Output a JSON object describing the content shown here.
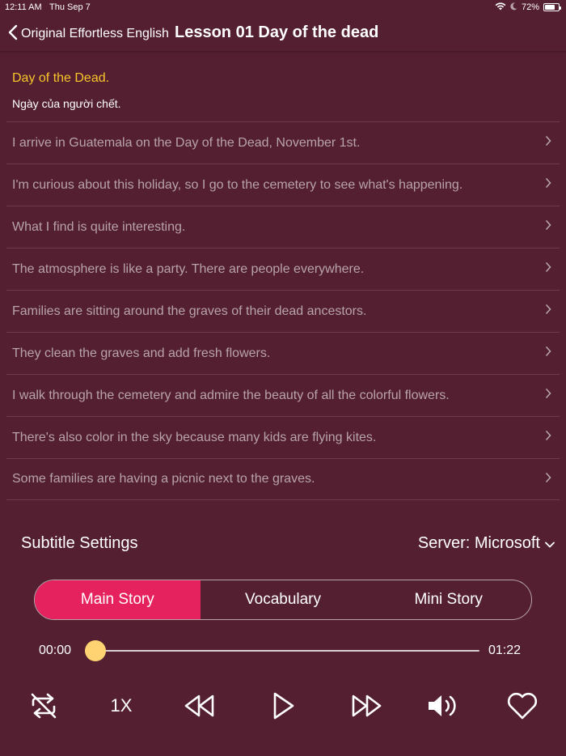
{
  "status_bar": {
    "time": "12:11 AM",
    "date": "Thu Sep 7",
    "battery": "72%",
    "battery_level": 0.72
  },
  "nav": {
    "back_label": "Original Effortless English",
    "title": "Lesson 01 Day of the dead"
  },
  "story": {
    "heading_en": "Day of the Dead.",
    "heading_vi": "Ngày của người chết.",
    "sentences": [
      "I arrive in Guatemala on the Day of the Dead, November 1st.",
      "I'm curious about this holiday, so I go to the cemetery to see what's happening.",
      "What I find is quite interesting.",
      "The atmosphere is like a party. There are people everywhere.",
      "Families are sitting around the graves of their dead ancestors.",
      "They clean the graves and add fresh flowers.",
      "I walk through the cemetery and admire the beauty of all the colorful flowers.",
      "There's also color in the sky because many kids are flying kites.",
      "Some families are having a picnic next to the graves."
    ]
  },
  "settings": {
    "subtitle_label": "Subtitle Settings",
    "server_label": "Server: Microsoft"
  },
  "tabs": {
    "main_story": "Main Story",
    "vocabulary": "Vocabulary",
    "mini_story": "Mini Story",
    "active": "main_story"
  },
  "player": {
    "current_time": "00:00",
    "total_time": "01:22",
    "progress": 0.0,
    "speed": "1X"
  },
  "colors": {
    "background": "#531f31",
    "accent": "#e6225e",
    "heading": "#f7c52a",
    "thumb": "#ffd272"
  },
  "icons": {
    "back": "chevron-left-icon",
    "row": "chevron-right-icon",
    "server": "chevron-down-icon",
    "repeat": "repeat-off-icon",
    "rewind": "rewind-icon",
    "play": "play-icon",
    "forward": "fast-forward-icon",
    "volume": "volume-icon",
    "favorite": "heart-icon"
  }
}
